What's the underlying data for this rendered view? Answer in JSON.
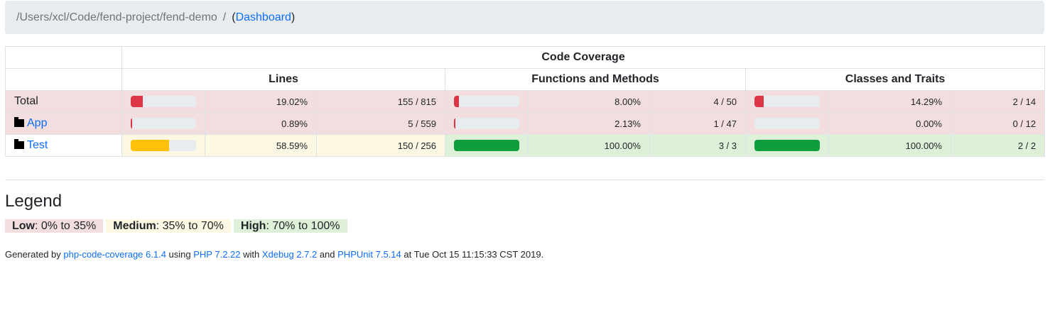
{
  "breadcrumb": {
    "path": "/Users/xcl/Code/fend-project/fend-demo",
    "separator": "/",
    "open_paren": "(",
    "dashboard_link": "Dashboard",
    "close_paren": ")"
  },
  "table": {
    "header_title": "Code Coverage",
    "groups": [
      "Lines",
      "Functions and Methods",
      "Classes and Traits"
    ],
    "rows": [
      {
        "name": "Total",
        "is_link": false,
        "class": "danger",
        "lines": {
          "pct": "19.02%",
          "count": "155 / 815",
          "value": 19.02,
          "level": "low"
        },
        "functions": {
          "pct": "8.00%",
          "count": "4 / 50",
          "value": 8.0,
          "level": "low"
        },
        "classes": {
          "pct": "14.29%",
          "count": "2 / 14",
          "value": 14.29,
          "level": "low"
        }
      },
      {
        "name": "App",
        "is_link": true,
        "class": "danger",
        "lines": {
          "pct": "0.89%",
          "count": "5 / 559",
          "value": 0.89,
          "level": "low"
        },
        "functions": {
          "pct": "2.13%",
          "count": "1 / 47",
          "value": 2.13,
          "level": "low"
        },
        "classes": {
          "pct": "0.00%",
          "count": "0 / 12",
          "value": 0.0,
          "level": "low"
        }
      },
      {
        "name": "Test",
        "is_link": true,
        "class": "warning",
        "lines": {
          "pct": "58.59%",
          "count": "150 / 256",
          "value": 58.59,
          "level": "medium"
        },
        "functions": {
          "pct": "100.00%",
          "count": "3 / 3",
          "value": 100.0,
          "level": "high"
        },
        "classes": {
          "pct": "100.00%",
          "count": "2 / 2",
          "value": 100.0,
          "level": "high"
        }
      }
    ]
  },
  "legend": {
    "title": "Legend",
    "low_label": "Low",
    "low_range": ": 0% to 35%",
    "medium_label": "Medium",
    "medium_range": ": 35% to 70%",
    "high_label": "High",
    "high_range": ": 70% to 100%"
  },
  "footer": {
    "generated_by": "Generated by ",
    "tool_link": "php-code-coverage 6.1.4",
    "using": " using ",
    "php_link": "PHP 7.2.22",
    "with": " with ",
    "xdebug_link": "Xdebug 2.7.2",
    "and": " and ",
    "phpunit_link": "PHPUnit 7.5.14",
    "at": " at Tue Oct 15 11:15:33 CST 2019."
  },
  "colors": {
    "low": "#dc3545",
    "medium": "#ffc107",
    "high": "#0f9d3e",
    "danger_bg": "#f2dede",
    "warning_bg": "#fcf8e3",
    "success_bg": "#dff0d8"
  }
}
